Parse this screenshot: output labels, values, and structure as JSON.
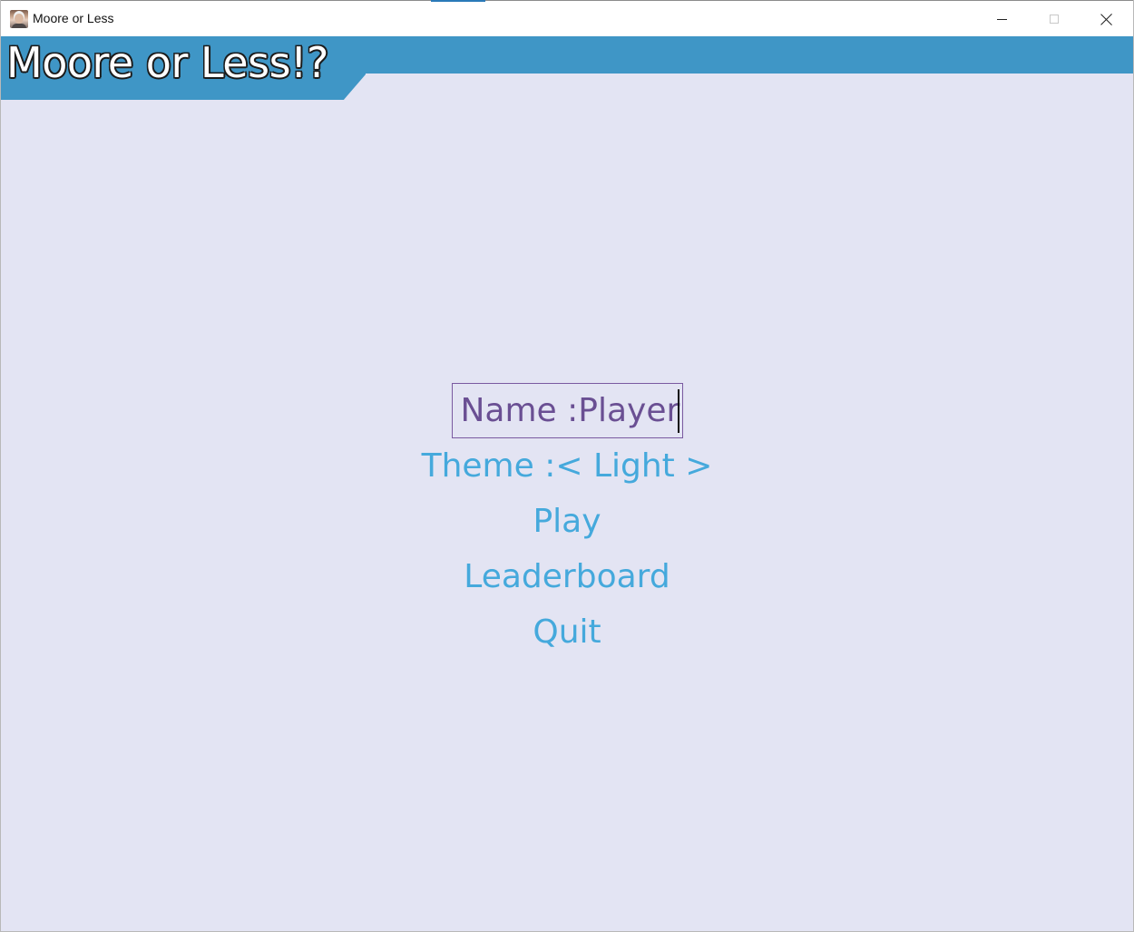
{
  "window": {
    "title": "Moore or Less",
    "controls": {
      "minimize_icon": "minimize-icon",
      "maximize_icon": "maximize-icon",
      "close_icon": "close-icon"
    }
  },
  "header": {
    "title": "Moore or Less!?",
    "color": "#3f96c6"
  },
  "menu": {
    "name_field": {
      "label": "Name :",
      "value": "Player"
    },
    "theme_label": "Theme :< Light >",
    "play_label": "Play",
    "leaderboard_label": "Leaderboard",
    "quit_label": "Quit",
    "item_color": "#45a9dc",
    "selected_color": "#6a4f93"
  },
  "background_color": "#e3e4f3"
}
